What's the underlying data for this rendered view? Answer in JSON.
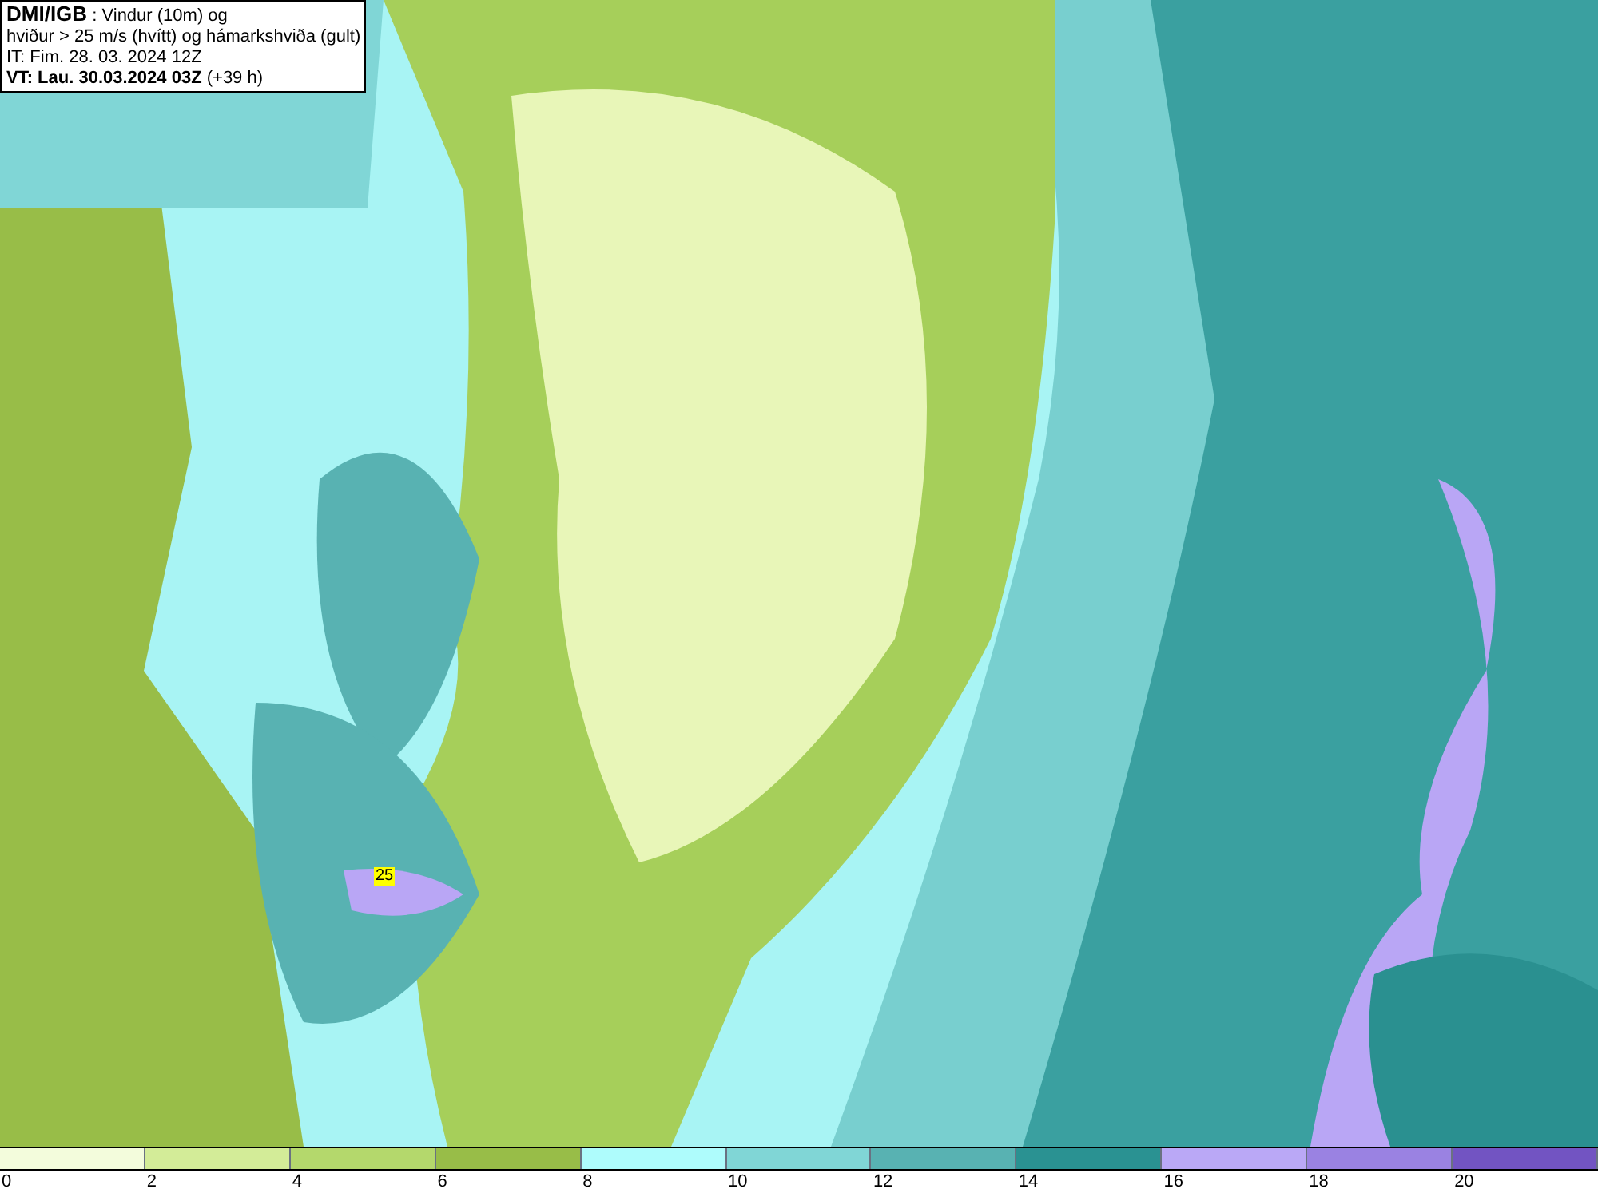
{
  "header": {
    "source": "DMI/IGB",
    "line_1": " : Vindur (10m) og",
    "line_2": "hviður > 25 m/s (hvítt) og hámarkshviða (gult)",
    "line_3": "IT: Fim. 28. 03. 2024 12Z",
    "line_4_bold": "VT: Lau. 30.03.2024 03Z",
    "line_4_rest": " (+39 h)"
  },
  "map": {
    "gust_label": "25"
  },
  "legend": {
    "bins": [
      {
        "color": "#f3fcdc"
      },
      {
        "color": "#d3ec98"
      },
      {
        "color": "#b4d86c"
      },
      {
        "color": "#98bd48"
      },
      {
        "color": "#aefcfc"
      },
      {
        "color": "#80d6d6"
      },
      {
        "color": "#58b2b2"
      },
      {
        "color": "#2a9292"
      },
      {
        "color": "#baa8f6"
      },
      {
        "color": "#9a82e2"
      },
      {
        "color": "#7254c2"
      }
    ],
    "ticks": [
      "0",
      "2",
      "4",
      "6",
      "8",
      "10",
      "12",
      "14",
      "16",
      "18",
      "20"
    ]
  }
}
